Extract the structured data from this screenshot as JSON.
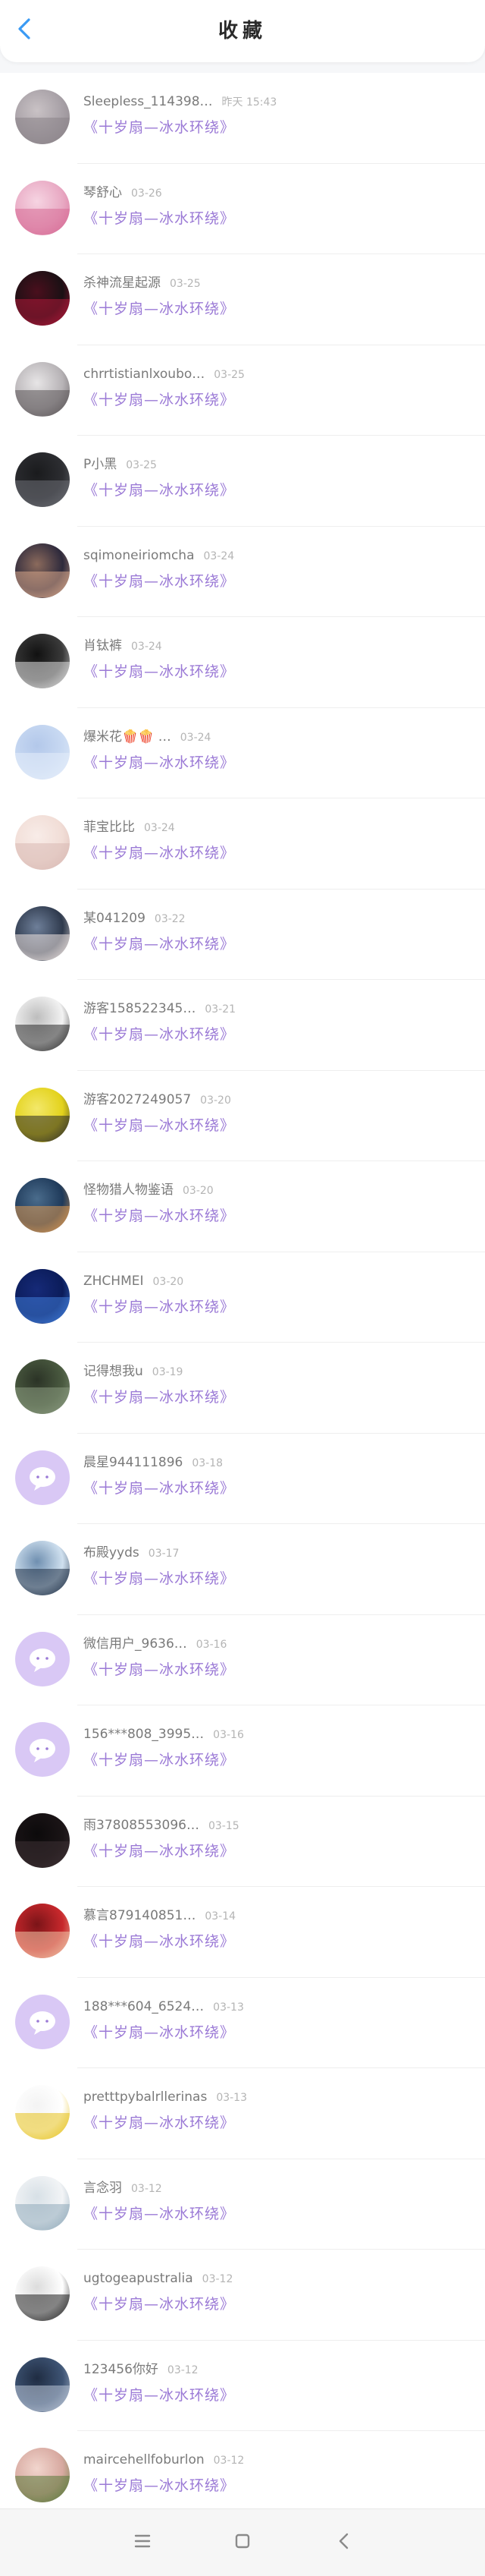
{
  "header": {
    "title": "收藏",
    "back_icon": "chevron-left-icon",
    "accent_color": "#3a9af4"
  },
  "colors": {
    "subtitle": "#9b7ad6",
    "name": "#7a7a7a",
    "time": "#b4b4b4",
    "placeholder_avatar_bg": "#d9c8f5"
  },
  "favorites": [
    {
      "name": "Sleepless_114398…",
      "time": "昨天 15:43",
      "subtitle": "《十岁扇—冰水环绕》",
      "avatar": {
        "kind": "photo",
        "c1": "#a7a0a6",
        "c2": "#8b8388",
        "c3": "#c9c2c5"
      }
    },
    {
      "name": "琴舒心",
      "time": "03-26",
      "subtitle": "《十岁扇—冰水环绕》",
      "avatar": {
        "kind": "photo",
        "c1": "#e8a9c3",
        "c2": "#d76b95",
        "c3": "#f6d4e2"
      }
    },
    {
      "name": "杀神流星起源",
      "time": "03-25",
      "subtitle": "《十岁扇—冰水环绕》",
      "avatar": {
        "kind": "photo",
        "c1": "#1b1014",
        "c2": "#b01739",
        "c3": "#4a0f1d"
      }
    },
    {
      "name": "chrrtistianlxoubo…",
      "time": "03-25",
      "subtitle": "《十岁扇—冰水环绕》",
      "avatar": {
        "kind": "photo",
        "c1": "#b7b3b6",
        "c2": "#5b5558",
        "c3": "#e7e5e6"
      }
    },
    {
      "name": "P小黑",
      "time": "03-25",
      "subtitle": "《十岁扇—冰水环绕》",
      "avatar": {
        "kind": "photo",
        "c1": "#2c2d31",
        "c2": "#6b6e74",
        "c3": "#1a1b1d"
      }
    },
    {
      "name": "sqimoneiriomcha",
      "time": "03-24",
      "subtitle": "《十岁扇—冰水环绕》",
      "avatar": {
        "kind": "photo",
        "c1": "#2e2a3c",
        "c2": "#d9a78a",
        "c3": "#8b6a5c"
      }
    },
    {
      "name": "肖钛裤",
      "time": "03-24",
      "subtitle": "《十岁扇—冰水环绕》",
      "avatar": {
        "kind": "photo",
        "c1": "#3a3a3a",
        "c2": "#e0e0e0",
        "c3": "#111111"
      }
    },
    {
      "name": "爆米花🍿🍿 …",
      "time": "03-24",
      "subtitle": "《十岁扇—冰水环绕》",
      "avatar": {
        "kind": "photo",
        "c1": "#c8d9f2",
        "c2": "#e4edf9",
        "c3": "#b3c8ea"
      }
    },
    {
      "name": "菲宝比比",
      "time": "03-24",
      "subtitle": "《十岁扇—冰水环绕》",
      "avatar": {
        "kind": "photo",
        "c1": "#f1ddd6",
        "c2": "#d9b9b4",
        "c3": "#f8ece8"
      }
    },
    {
      "name": "某041209",
      "time": "03-22",
      "subtitle": "《十岁扇—冰水环绕》",
      "avatar": {
        "kind": "photo",
        "c1": "#2f3a4d",
        "c2": "#f0e6e2",
        "c3": "#6e7f99"
      }
    },
    {
      "name": "游客158522345…",
      "time": "03-21",
      "subtitle": "《十岁扇—冰水环绕》",
      "avatar": {
        "kind": "photo",
        "c1": "#f2f2f2",
        "c2": "#2b2b2b",
        "c3": "#bdbdbd"
      }
    },
    {
      "name": "游客2027249057",
      "time": "03-20",
      "subtitle": "《十岁扇—冰水环绕》",
      "avatar": {
        "kind": "photo",
        "c1": "#e3d21b",
        "c2": "#2a2a2a",
        "c3": "#f3e86a"
      }
    },
    {
      "name": "怪物猎人物鉴语",
      "time": "03-20",
      "subtitle": "《十岁扇—冰水环绕》",
      "avatar": {
        "kind": "photo",
        "c1": "#1f3a5a",
        "c2": "#e09a52",
        "c3": "#4a6c8c"
      }
    },
    {
      "name": "ZHCHMEI",
      "time": "03-20",
      "subtitle": "《十岁扇—冰水环绕》",
      "avatar": {
        "kind": "photo",
        "c1": "#0b1c5a",
        "c2": "#3f7bd8",
        "c3": "#162a78"
      }
    },
    {
      "name": "记得想我u",
      "time": "03-19",
      "subtitle": "《十岁扇—冰水环绕》",
      "avatar": {
        "kind": "photo",
        "c1": "#4a5a40",
        "c2": "#8a9a80",
        "c3": "#2b3326"
      }
    },
    {
      "name": "晨星944111896",
      "time": "03-18",
      "subtitle": "《十岁扇—冰水环绕》",
      "avatar": {
        "kind": "placeholder"
      }
    },
    {
      "name": "布殿yyds",
      "time": "03-17",
      "subtitle": "《十岁扇—冰水环绕》",
      "avatar": {
        "kind": "photo",
        "c1": "#cfe0ef",
        "c2": "#1f2f45",
        "c3": "#6f8fb0"
      }
    },
    {
      "name": "微信用户_9636…",
      "time": "03-16",
      "subtitle": "《十岁扇—冰水环绕》",
      "avatar": {
        "kind": "placeholder"
      }
    },
    {
      "name": "156***808_3995…",
      "time": "03-16",
      "subtitle": "《十岁扇—冰水环绕》",
      "avatar": {
        "kind": "placeholder"
      }
    },
    {
      "name": "雨37808553096…",
      "time": "03-15",
      "subtitle": "《十岁扇—冰水环绕》",
      "avatar": {
        "kind": "photo",
        "c1": "#1a1416",
        "c2": "#3c2f33",
        "c3": "#0c0a0b"
      }
    },
    {
      "name": "慕言879140851…",
      "time": "03-14",
      "subtitle": "《十岁扇—冰水环绕》",
      "avatar": {
        "kind": "photo",
        "c1": "#c8282c",
        "c2": "#f0c7a8",
        "c3": "#7a1418"
      }
    },
    {
      "name": "188***604_6524…",
      "time": "03-13",
      "subtitle": "《十岁扇—冰水环绕》",
      "avatar": {
        "kind": "placeholder"
      }
    },
    {
      "name": "pretttpybalrllerinas",
      "time": "03-13",
      "subtitle": "《十岁扇—冰水环绕》",
      "avatar": {
        "kind": "photo",
        "c1": "#ffffff",
        "c2": "#e6c11a",
        "c3": "#f3f3f3"
      }
    },
    {
      "name": "言念羽",
      "time": "03-12",
      "subtitle": "《十岁扇—冰水环绕》",
      "avatar": {
        "kind": "photo",
        "c1": "#f2f4f6",
        "c2": "#8fa9b9",
        "c3": "#d7e0e6"
      }
    },
    {
      "name": "ugtogeapustralia",
      "time": "03-12",
      "subtitle": "《十岁扇—冰水环绕》",
      "avatar": {
        "kind": "photo",
        "c1": "#ffffff",
        "c2": "#1f1f1f",
        "c3": "#dcdcdc"
      }
    },
    {
      "name": "123456你好",
      "time": "03-12",
      "subtitle": "《十岁扇—冰水环绕》",
      "avatar": {
        "kind": "photo",
        "c1": "#3e5474",
        "c2": "#b9c5d6",
        "c3": "#1f2c42"
      }
    },
    {
      "name": "maircehellfoburlon",
      "time": "03-12",
      "subtitle": "《十岁扇—冰水环绕》",
      "avatar": {
        "kind": "photo",
        "c1": "#d7a9a0",
        "c2": "#5a7a3a",
        "c3": "#f1d5cd"
      }
    }
  ],
  "navbar": {
    "menu_icon": "menu-icon",
    "home_icon": "home-square-icon",
    "back_icon": "back-triangle-icon"
  }
}
